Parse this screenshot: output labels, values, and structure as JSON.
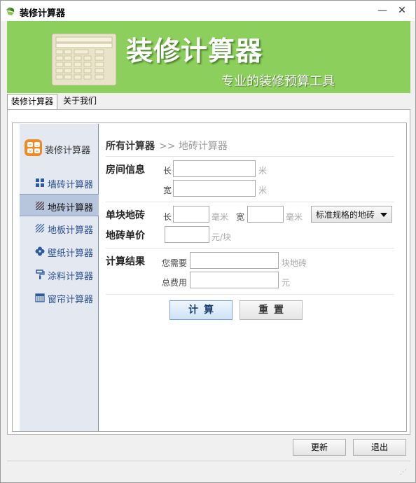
{
  "window": {
    "title": "装修计算器",
    "minimize_glyph": "—",
    "close_glyph": "✕"
  },
  "banner": {
    "title": "装修计算器",
    "subtitle": "专业的装修预算工具",
    "background_color": "#8ccf5c"
  },
  "tabs": [
    {
      "label": "装修计算器",
      "active": true
    },
    {
      "label": "关于我们",
      "active": false
    }
  ],
  "sidebar": {
    "header": "装修计算器",
    "items": [
      {
        "label": "墙砖计算器",
        "icon": "grid-tiles-icon",
        "active": false
      },
      {
        "label": "地砖计算器",
        "icon": "floor-tile-icon",
        "active": true
      },
      {
        "label": "地板计算器",
        "icon": "wood-floor-icon",
        "active": false
      },
      {
        "label": "壁纸计算器",
        "icon": "flower-icon",
        "active": false
      },
      {
        "label": "涂料计算器",
        "icon": "paint-roller-icon",
        "active": false
      },
      {
        "label": "窗帘计算器",
        "icon": "curtain-icon",
        "active": false
      }
    ]
  },
  "breadcrumb": {
    "root": "所有计算器",
    "separator": ">>",
    "current": "地砖计算器"
  },
  "form": {
    "room": {
      "label": "房间信息",
      "length_label": "长",
      "width_label": "宽",
      "length_value": "",
      "width_value": "",
      "unit": "米"
    },
    "tile": {
      "label": "单块地砖",
      "length_label": "长",
      "width_label": "宽",
      "length_value": "",
      "width_value": "",
      "unit": "毫米",
      "spec_selected": "标准规格的地砖"
    },
    "price": {
      "label": "地砖单价",
      "value": "",
      "unit": "元/块"
    },
    "result": {
      "label": "计算结果",
      "need_label": "您需要",
      "need_value": "",
      "need_unit": "块地砖",
      "total_label": "总费用",
      "total_value": "",
      "total_unit": "元"
    }
  },
  "buttons": {
    "calculate": "计算",
    "reset": "重置",
    "update": "更新",
    "exit": "退出"
  },
  "statusbar": {
    "grip": "⋰"
  }
}
